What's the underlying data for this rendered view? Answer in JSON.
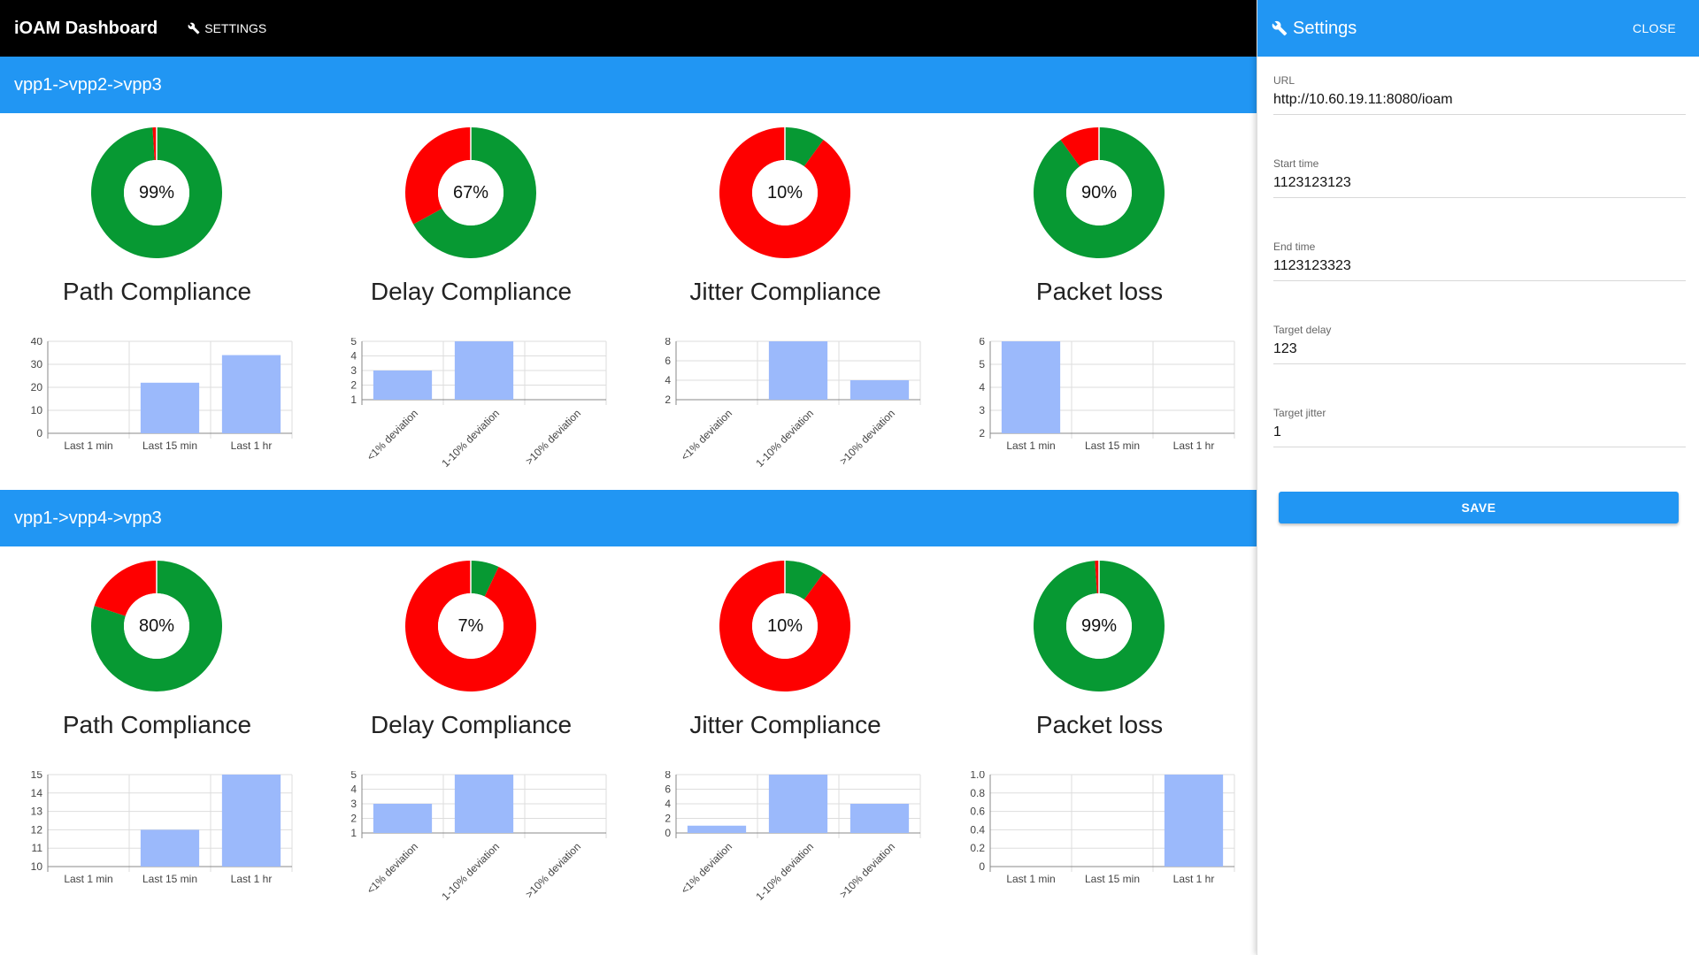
{
  "header": {
    "app_title": "iOAM Dashboard",
    "settings_label": "SETTINGS"
  },
  "colors": {
    "good": "#079933",
    "bad": "#fe0000",
    "bar": "#9bb9fb",
    "accent": "#2196f3"
  },
  "sections": [
    {
      "title": "vpp1->vpp2->vpp3",
      "cards": [
        {
          "title": "Path Compliance",
          "percent_label": "99%",
          "percent": 99,
          "chart_data": {
            "type": "bar",
            "categories": [
              "Last 1 min",
              "Last 15 min",
              "Last 1 hr"
            ],
            "values": [
              0,
              22,
              34
            ],
            "yticks": [
              0,
              10,
              20,
              30,
              40
            ],
            "ylim": [
              0,
              40
            ],
            "rotated_labels": false
          }
        },
        {
          "title": "Delay Compliance",
          "percent_label": "67%",
          "percent": 67,
          "chart_data": {
            "type": "bar",
            "categories": [
              "<1% deviation",
              "1-10% deviation",
              ">10% deviation"
            ],
            "values": [
              3,
              5,
              1
            ],
            "yticks": [
              1,
              2,
              3,
              4,
              5
            ],
            "ylim": [
              1,
              5
            ],
            "rotated_labels": true
          }
        },
        {
          "title": "Jitter Compliance",
          "percent_label": "10%",
          "percent": 10,
          "chart_data": {
            "type": "bar",
            "categories": [
              "<1% deviation",
              "1-10% deviation",
              ">10% deviation"
            ],
            "values": [
              2,
              8,
              4
            ],
            "yticks": [
              2,
              4,
              6,
              8
            ],
            "ylim": [
              2,
              8
            ],
            "rotated_labels": true
          }
        },
        {
          "title": "Packet loss",
          "percent_label": "90%",
          "percent": 90,
          "chart_data": {
            "type": "bar",
            "categories": [
              "Last 1 min",
              "Last 15 min",
              "Last 1 hr"
            ],
            "values": [
              6,
              2,
              2
            ],
            "yticks": [
              2,
              3,
              4,
              5,
              6
            ],
            "ylim": [
              2,
              6
            ],
            "rotated_labels": false
          }
        }
      ]
    },
    {
      "title": "vpp1->vpp4->vpp3",
      "cards": [
        {
          "title": "Path Compliance",
          "percent_label": "80%",
          "percent": 80,
          "chart_data": {
            "type": "bar",
            "categories": [
              "Last 1 min",
              "Last 15 min",
              "Last 1 hr"
            ],
            "values": [
              10,
              12,
              15
            ],
            "yticks": [
              10,
              11,
              12,
              13,
              14,
              15
            ],
            "ylim": [
              10,
              15
            ],
            "rotated_labels": false
          }
        },
        {
          "title": "Delay Compliance",
          "percent_label": "7%",
          "percent": 7,
          "chart_data": {
            "type": "bar",
            "categories": [
              "<1% deviation",
              "1-10% deviation",
              ">10% deviation"
            ],
            "values": [
              3,
              5,
              1
            ],
            "yticks": [
              1,
              2,
              3,
              4,
              5
            ],
            "ylim": [
              1,
              5
            ],
            "rotated_labels": true
          }
        },
        {
          "title": "Jitter Compliance",
          "percent_label": "10%",
          "percent": 10,
          "chart_data": {
            "type": "bar",
            "categories": [
              "<1% deviation",
              "1-10% deviation",
              ">10% deviation"
            ],
            "values": [
              1,
              8,
              4
            ],
            "yticks": [
              0,
              2,
              4,
              6,
              8
            ],
            "ylim": [
              0,
              8
            ],
            "rotated_labels": true
          }
        },
        {
          "title": "Packet loss",
          "percent_label": "99%",
          "percent": 99,
          "chart_data": {
            "type": "bar",
            "categories": [
              "Last 1 min",
              "Last 15 min",
              "Last 1 hr"
            ],
            "values": [
              0,
              0,
              1.0
            ],
            "yticks": [
              0,
              0.2,
              0.4,
              0.6,
              0.8,
              1.0
            ],
            "ytick_labels": [
              "0",
              "0.2",
              "0.4",
              "0.6",
              "0.8",
              "1.0"
            ],
            "ylim": [
              0,
              1.0
            ],
            "rotated_labels": false
          }
        }
      ]
    }
  ],
  "settings_panel": {
    "title": "Settings",
    "close_label": "CLOSE",
    "fields": {
      "url": {
        "label": "URL",
        "value": "http://10.60.19.11:8080/ioam"
      },
      "start_time": {
        "label": "Start time",
        "value": "1123123123"
      },
      "end_time": {
        "label": "End time",
        "value": "1123123323"
      },
      "target_delay": {
        "label": "Target delay",
        "value": "123"
      },
      "target_jitter": {
        "label": "Target jitter",
        "value": "1"
      }
    },
    "save_label": "SAVE"
  }
}
